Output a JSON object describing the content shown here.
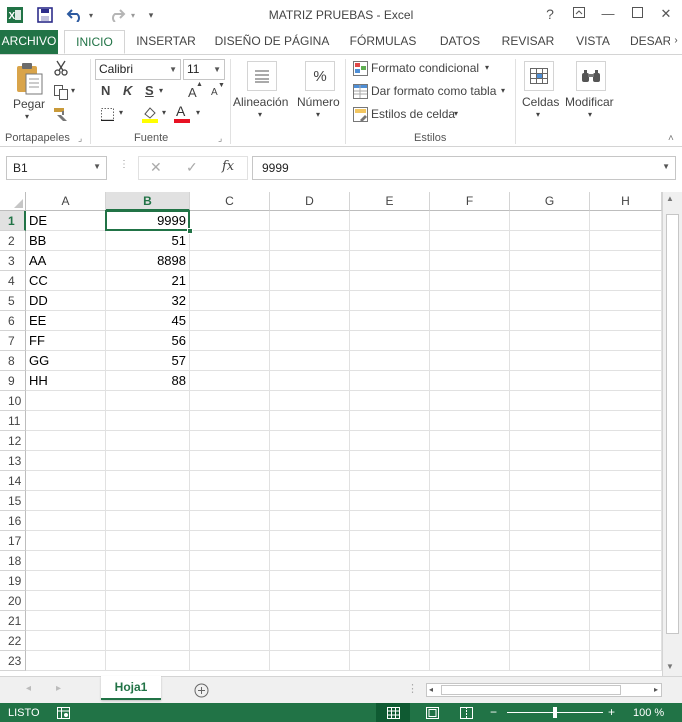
{
  "window": {
    "title": "MATRIZ PRUEBAS - Excel",
    "help": "?",
    "min": "—",
    "close": "✕"
  },
  "tabs": [
    {
      "label": "ARCHIVO"
    },
    {
      "label": "INICIO"
    },
    {
      "label": "INSERTAR"
    },
    {
      "label": "DISEÑO DE PÁGINA"
    },
    {
      "label": "FÓRMULAS"
    },
    {
      "label": "DATOS"
    },
    {
      "label": "REVISAR"
    },
    {
      "label": "VISTA"
    },
    {
      "label": "DESAR"
    }
  ],
  "ribbon": {
    "clipboard": {
      "paste": "Pegar",
      "label": "Portapapeles"
    },
    "font": {
      "name": "Calibri",
      "size": "11",
      "bold": "N",
      "italic": "K",
      "underline": "S",
      "grow": "A",
      "shrink": "A",
      "color_letter": "A",
      "label": "Fuente"
    },
    "alignment": {
      "label": "Alineación"
    },
    "number": {
      "label": "Número",
      "symbol": "%"
    },
    "styles": {
      "conditional": "Formato condicional",
      "as_table": "Dar formato como tabla",
      "cell_styles": "Estilos de celda",
      "label": "Estilos"
    },
    "cells": {
      "label": "Celdas"
    },
    "edit": {
      "label": "Modificar"
    }
  },
  "formula_bar": {
    "name_box": "B1",
    "cancel": "✕",
    "enter": "✓",
    "fx": "fx",
    "value": "9999"
  },
  "sheet": {
    "columns": [
      "A",
      "B",
      "C",
      "D",
      "E",
      "F",
      "G",
      "H"
    ],
    "selected_column": "B",
    "selected_row": 1,
    "rows": [
      "1",
      "2",
      "3",
      "4",
      "5",
      "6",
      "7",
      "8",
      "9",
      "10",
      "11",
      "12",
      "13",
      "14",
      "15",
      "16",
      "17",
      "18",
      "19",
      "20",
      "21",
      "22",
      "23"
    ],
    "data": [
      {
        "a": "DE",
        "b": "9999"
      },
      {
        "a": "BB",
        "b": "51"
      },
      {
        "a": "AA",
        "b": "8898"
      },
      {
        "a": "CC",
        "b": "21"
      },
      {
        "a": "DD",
        "b": "32"
      },
      {
        "a": "EE",
        "b": "45"
      },
      {
        "a": "FF",
        "b": "56"
      },
      {
        "a": "GG",
        "b": "57"
      },
      {
        "a": "HH",
        "b": "88"
      }
    ]
  },
  "sheet_tabs": {
    "active": "Hoja1"
  },
  "status": {
    "ready": "LISTO",
    "zoom": "100 %"
  },
  "colors": {
    "accent": "#217346"
  }
}
